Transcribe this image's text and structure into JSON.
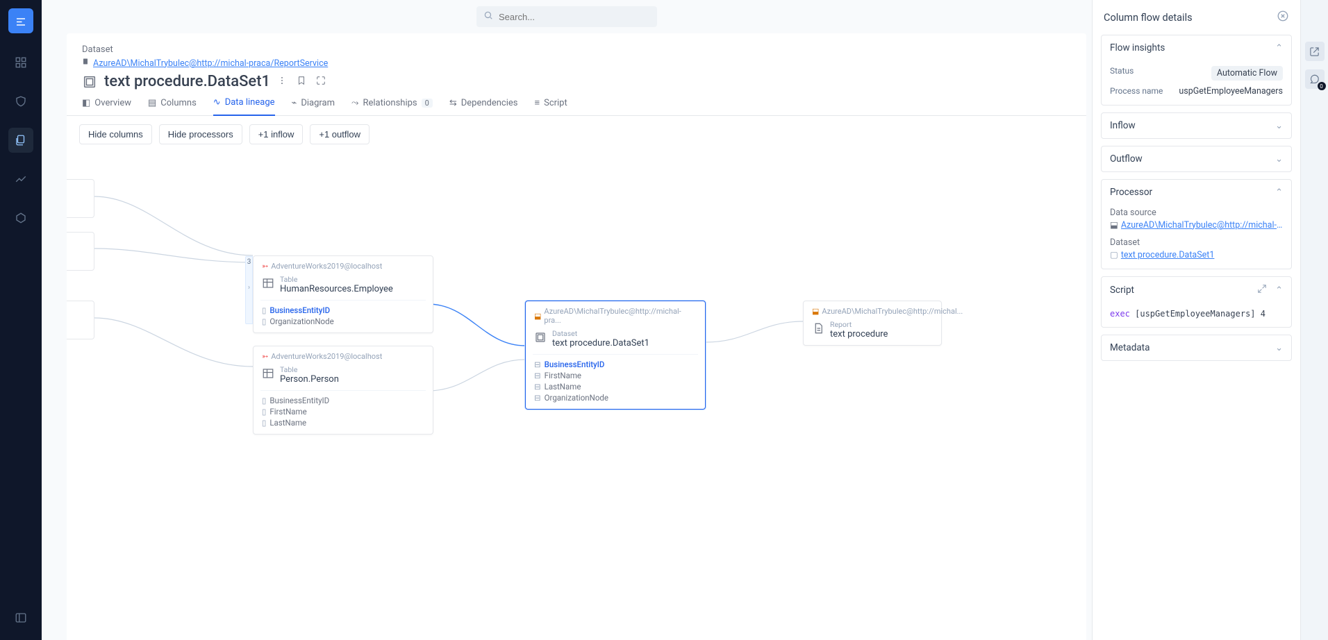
{
  "search": {
    "placeholder": "Search..."
  },
  "breadcrumb": {
    "category": "Dataset",
    "path": "AzureAD\\MichalTrybulec@http://michal-praca/ReportService"
  },
  "page": {
    "title": "text procedure.DataSet1"
  },
  "tabs": {
    "overview": "Overview",
    "columns": "Columns",
    "data_lineage": "Data lineage",
    "diagram": "Diagram",
    "relationships": "Relationships",
    "relationships_count": "0",
    "dependencies": "Dependencies",
    "script": "Script"
  },
  "toolbar": {
    "hide_columns": "Hide columns",
    "hide_processors": "Hide processors",
    "inflow": "+1 inflow",
    "outflow": "+1 outflow"
  },
  "lineage": {
    "node1": {
      "badge": "3",
      "db": "AdventureWorks2019@localhost",
      "type": "Table",
      "name": "HumanResources.Employee",
      "cols": [
        "BusinessEntityID",
        "OrganizationNode"
      ]
    },
    "node2": {
      "db": "AdventureWorks2019@localhost",
      "type": "Table",
      "name": "Person.Person",
      "cols": [
        "BusinessEntityID",
        "FirstName",
        "LastName"
      ]
    },
    "node3": {
      "db": "AzureAD\\MichalTrybulec@http://michal-pra...",
      "type": "Dataset",
      "name": "text procedure.DataSet1",
      "cols": [
        "BusinessEntityID",
        "FirstName",
        "LastName",
        "OrganizationNode"
      ]
    },
    "node4": {
      "db": "AzureAD\\MichalTrybulec@http://michal...",
      "type": "Report",
      "name": "text procedure"
    }
  },
  "detail_panel": {
    "title": "Column flow details",
    "flow_insights": {
      "title": "Flow insights",
      "status_label": "Status",
      "status_value": "Automatic Flow",
      "process_label": "Process name",
      "process_value": "uspGetEmployeeManagers"
    },
    "inflow_title": "Inflow",
    "outflow_title": "Outflow",
    "processor": {
      "title": "Processor",
      "datasource_label": "Data source",
      "datasource_value": "AzureAD\\MichalTrybulec@http://michal-pra/...",
      "dataset_label": "Dataset",
      "dataset_value": "text procedure.DataSet1"
    },
    "script": {
      "title": "Script",
      "code_kw": "exec",
      "code_rest": " [uspGetEmployeeManagers] 4"
    },
    "metadata_title": "Metadata"
  },
  "right_rail_badge": "0"
}
